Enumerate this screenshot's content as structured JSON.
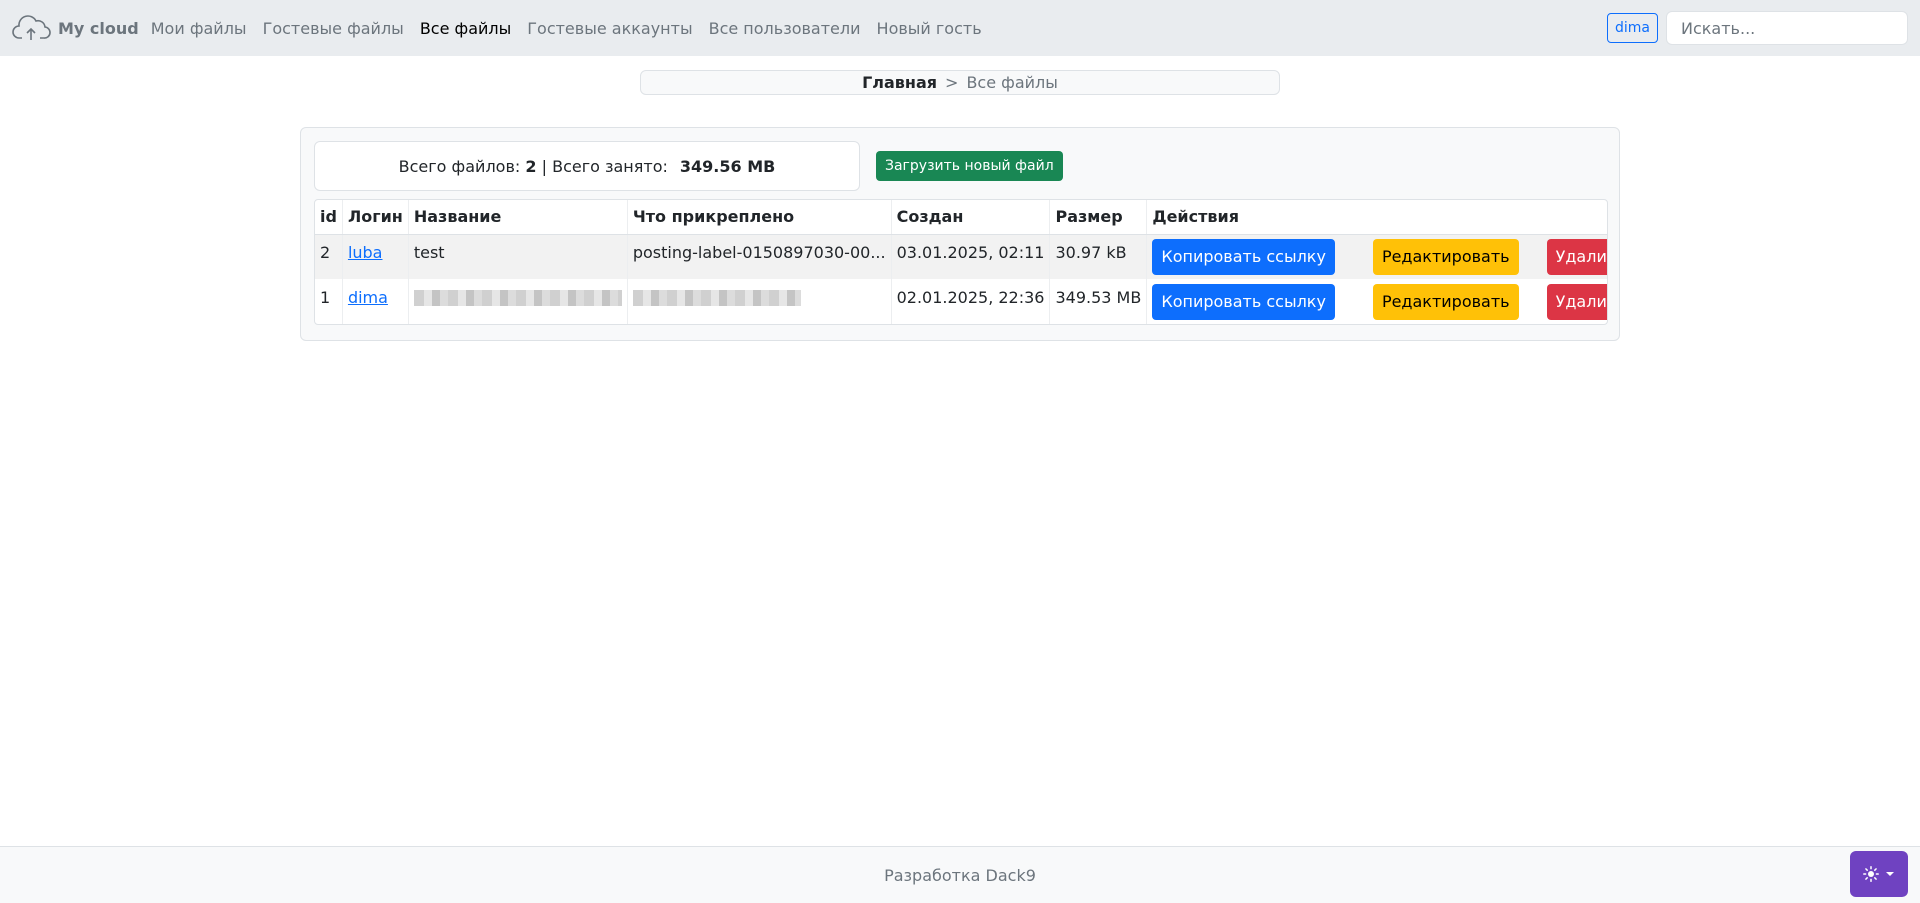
{
  "navbar": {
    "brand": "My cloud",
    "brand_icon": "cloud-upload-icon",
    "links": [
      {
        "label": "Мои файлы",
        "active": false
      },
      {
        "label": "Гостевые файлы",
        "active": false
      },
      {
        "label": "Все файлы",
        "active": true
      },
      {
        "label": "Гостевые аккаунты",
        "active": false
      },
      {
        "label": "Все пользователи",
        "active": false
      },
      {
        "label": "Новый гость",
        "active": false
      }
    ],
    "user": "dima",
    "search": {
      "placeholder": "Искать..."
    }
  },
  "breadcrumb": {
    "home": "Главная",
    "separator": ">",
    "current": "Все файлы"
  },
  "summary": {
    "files_label": "Всего файлов:",
    "files_count": "2",
    "divider": "|",
    "used_label": "Всего занято:",
    "used_value": "349.56 MB"
  },
  "upload_button": "Загрузить новый файл",
  "table": {
    "headers": [
      "id",
      "Логин",
      "Название",
      "Что прикреплено",
      "Создан",
      "Размер",
      "Действия"
    ],
    "rows": [
      {
        "id": "2",
        "login": "luba",
        "name": "test",
        "attached": "posting-label-0150897030-00...",
        "created": "03.01.2025, 02:11",
        "size": "30.97 kB"
      },
      {
        "id": "1",
        "login": "dima",
        "name": "",
        "attached": "",
        "created": "02.01.2025, 22:36",
        "size": "349.53 MB"
      }
    ],
    "actions": {
      "copy": "Копировать ссылку",
      "edit": "Редактировать",
      "delete": "Удалить"
    }
  },
  "footer": {
    "text": "Разработка Dack9"
  },
  "theme_toggle": {
    "icon": "sun-icon",
    "caret_icon": "caret-down-icon"
  },
  "colors": {
    "primary": "#0d6efd",
    "success": "#198754",
    "warning": "#ffc107",
    "danger": "#dc3545",
    "theme": "#6f42c1"
  }
}
